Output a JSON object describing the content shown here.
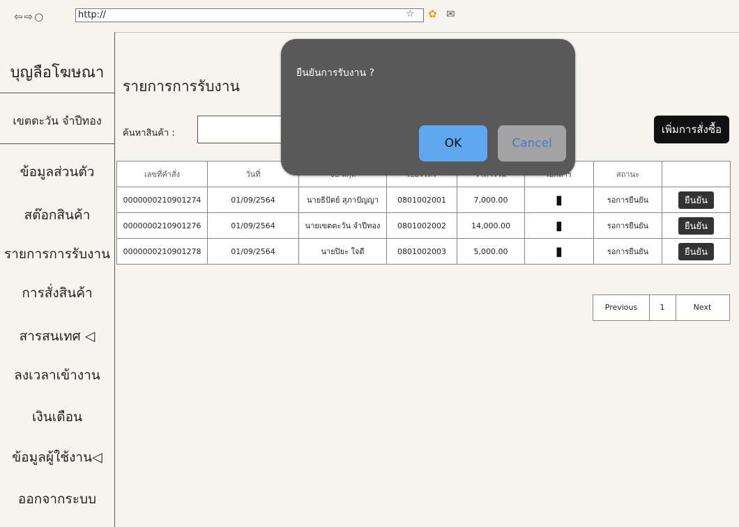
{
  "browser": {
    "nav_icons": "⇦⇨○",
    "url": "http://",
    "star": "☆",
    "extension_icon": "✿",
    "mail_icon": "✉"
  },
  "sidebar": {
    "brand": "บุญลือโฆษณา",
    "user_name": "เขตตะวัน จำปีทอง",
    "items": [
      {
        "label": "ข้อมูลส่วนตัว"
      },
      {
        "label": "สต๊อกสินค้า"
      },
      {
        "label": "รายการการรับงาน"
      },
      {
        "label": "การสั่งสินค้า"
      },
      {
        "label": "สารสนเทศ ◁"
      },
      {
        "label": "ลงเวลาเข้างาน"
      },
      {
        "label": "เงินเดือน"
      },
      {
        "label": "ข้อมูลผู้ใช้งาน◁"
      },
      {
        "label": "ออกจากระบบ"
      }
    ]
  },
  "main": {
    "title": "รายการการรับงาน",
    "search_label": "ค้นหาสินค้า :",
    "search_value": "",
    "add_order_label": "เพิ่มการสั่งซื้อ"
  },
  "table": {
    "headers": [
      "เลขที่คำสั่ง",
      "วันที่",
      "ชื่อ-สกุล",
      "เบอร์โทร",
      "ราคารวม",
      "เอกสาร",
      "สถานะ",
      ""
    ],
    "rows": [
      {
        "order": "0000000210901274",
        "date": "01/09/2564",
        "name": "นายธิปัตย์ สุภาปัญญา",
        "phone": "0801002001",
        "total": "7,000.00",
        "status": "รอการยืนยัน",
        "action": "ยืนยัน"
      },
      {
        "order": "0000000210901276",
        "date": "01/09/2564",
        "name": "นายเขตตะวัน จำปีทอง",
        "phone": "0801002002",
        "total": "14,000.00",
        "status": "รอการยืนยัน",
        "action": "ยืนยัน"
      },
      {
        "order": "0000000210901278",
        "date": "01/09/2564",
        "name": "นายปิยะ ใจดี",
        "phone": "0801002003",
        "total": "5,000.00",
        "status": "รอการยืนยัน",
        "action": "ยืนยัน"
      }
    ],
    "document_icon": "document-icon"
  },
  "pagination": {
    "previous": "Previous",
    "page": "1",
    "next": "Next"
  },
  "modal": {
    "message": "ยืนยันการรับงาน ?",
    "ok": "OK",
    "cancel": "Cancel"
  },
  "colors": {
    "ok_button": "#5ea8f0",
    "cancel_button": "#a3a3a3",
    "modal_bg": "#595959",
    "dark_button": "#111111"
  }
}
